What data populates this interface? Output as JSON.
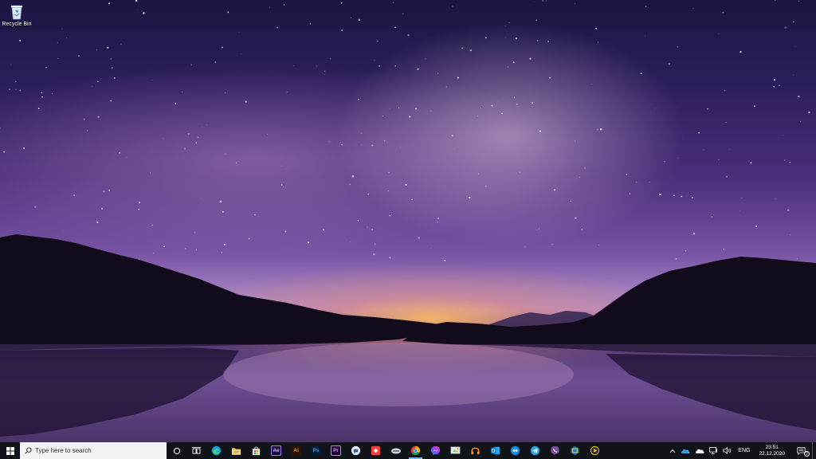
{
  "desktop": {
    "icons": [
      {
        "label": "Recycle Bin",
        "icon": "recycle-bin-icon"
      }
    ]
  },
  "taskbar": {
    "search": {
      "placeholder": "Type here to search"
    },
    "apps": [
      {
        "id": "cortana",
        "icon": "cortana-circle-icon"
      },
      {
        "id": "task-view",
        "icon": "task-view-icon"
      },
      {
        "id": "edge",
        "icon": "edge-icon",
        "color": "#1fa0e6"
      },
      {
        "id": "file-explorer",
        "icon": "folder-icon",
        "color": "#f2c14e"
      },
      {
        "id": "store",
        "icon": "store-bag-icon",
        "color": "#f0f0f0"
      },
      {
        "id": "after-effects",
        "icon": "after-effects-icon",
        "text": "Ae",
        "bg": "#1a0b3a",
        "fg": "#c9a8ff",
        "border": "#9a7cff"
      },
      {
        "id": "illustrator",
        "icon": "illustrator-icon",
        "text": "Ai",
        "bg": "#2b1200",
        "fg": "#ff9a00",
        "border": "#ff9a00"
      },
      {
        "id": "photoshop",
        "icon": "photoshop-icon",
        "text": "Ps",
        "bg": "#001a33",
        "fg": "#31a8ff",
        "border": "#31a8ff"
      },
      {
        "id": "premiere",
        "icon": "premiere-icon",
        "text": "Pr",
        "bg": "#1f0033",
        "fg": "#e08cff",
        "border": "#c77dff"
      },
      {
        "id": "signal-app",
        "icon": "chat-bubble-icon",
        "color": "#5b9bd5"
      },
      {
        "id": "anydesk",
        "icon": "anydesk-icon",
        "color": "#ef443b"
      },
      {
        "id": "mouse-app",
        "icon": "mouse-icon",
        "color": "#cfd6de"
      },
      {
        "id": "chrome",
        "icon": "chrome-icon",
        "active": true
      },
      {
        "id": "messenger",
        "icon": "messenger-icon",
        "color": "#a64dff"
      },
      {
        "id": "snipping",
        "icon": "snipping-tool-icon",
        "color": "#9ad14b"
      },
      {
        "id": "headphones",
        "icon": "headphones-icon",
        "color": "#ff8a1f"
      },
      {
        "id": "outlook",
        "icon": "outlook-icon",
        "color": "#0f6cbd"
      },
      {
        "id": "teamviewer",
        "icon": "teamviewer-icon",
        "color": "#0e8ee9"
      },
      {
        "id": "telegram",
        "icon": "telegram-icon",
        "color": "#2ca5e0"
      },
      {
        "id": "viber",
        "icon": "viber-icon",
        "color": "#7b519d"
      },
      {
        "id": "virtualbox",
        "icon": "virtualbox-icon",
        "color": "#1b75bb"
      },
      {
        "id": "potplayer",
        "icon": "potplayer-icon",
        "color": "#f5c518"
      }
    ],
    "tray": {
      "language": "ENG",
      "time": "23:51",
      "date": "22.12.2020",
      "notification_count": "2"
    }
  }
}
